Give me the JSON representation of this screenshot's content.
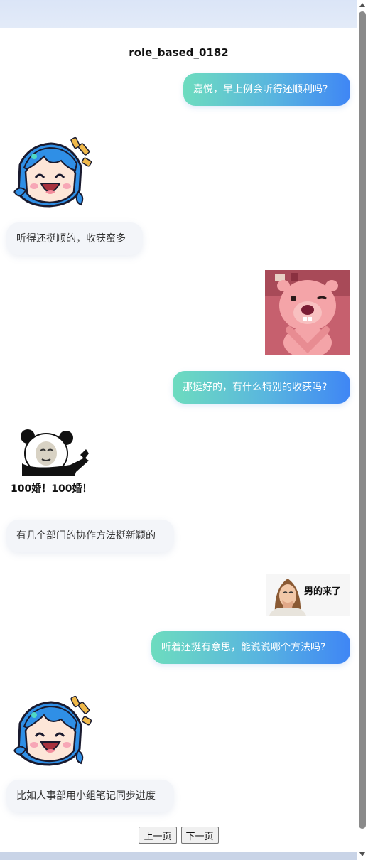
{
  "chat": {
    "title": "role_based_0182",
    "messages": [
      {
        "role": "user",
        "text": "嘉悦，早上例会听得还顺利吗?"
      },
      {
        "role": "bot",
        "sticker": "blue-hair-laughing-girl-icon"
      },
      {
        "role": "bot",
        "text": "听得还挺顺的，收获蛮多"
      },
      {
        "role": "user",
        "sticker": "pink-beaver-wink-icon"
      },
      {
        "role": "user",
        "text": "那挺好的，有什么特别的收获吗?"
      },
      {
        "role": "bot",
        "sticker": "panda-meme-icon",
        "caption": "100婚！100婚！"
      },
      {
        "role": "bot",
        "text": "有几个部门的协作方法挺新颖的"
      },
      {
        "role": "user",
        "sticker": "woman-laughing-meme-icon",
        "caption": "男的来了"
      },
      {
        "role": "user",
        "text": "听着还挺有意思，能说说哪个方法吗?"
      },
      {
        "role": "bot",
        "sticker": "blue-hair-laughing-girl-icon"
      },
      {
        "role": "bot",
        "text": "比如人事部用小组笔记同步进度"
      }
    ]
  },
  "pager": {
    "prev_label": "上一页",
    "next_label": "下一页"
  },
  "colors": {
    "user_bubble_start": "#6ddcbf",
    "user_bubble_end": "#3f86f5",
    "bot_bubble": "#f3f5f9"
  }
}
